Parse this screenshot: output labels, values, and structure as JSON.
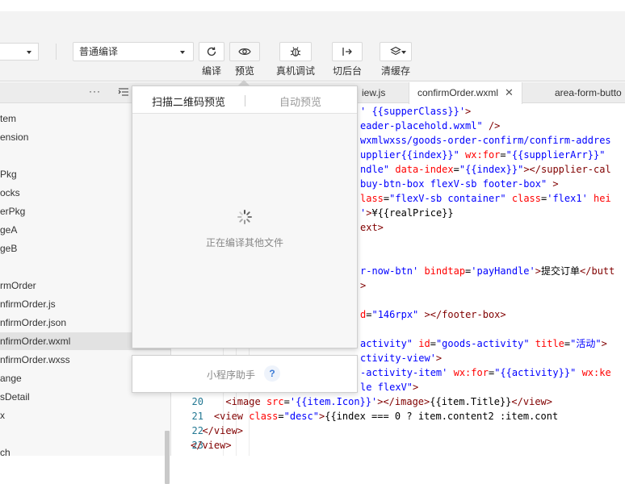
{
  "toolbar": {
    "left_select_value": "",
    "compile_mode_value": "普通编译",
    "buttons": [
      {
        "label": "编译",
        "icon": "refresh-icon"
      },
      {
        "label": "预览",
        "icon": "eye-icon"
      },
      {
        "label": "真机调试",
        "icon": "bug-icon"
      },
      {
        "label": "切后台",
        "icon": "switch-background-icon"
      },
      {
        "label": "清缓存",
        "icon": "layers-icon"
      }
    ]
  },
  "sidebar": {
    "header_more": "···",
    "items": [
      {
        "label": "tem",
        "selected": false
      },
      {
        "label": "ension",
        "selected": false
      },
      {
        "label": "",
        "selected": false
      },
      {
        "label": "Pkg",
        "selected": false
      },
      {
        "label": "ocks",
        "selected": false
      },
      {
        "label": "erPkg",
        "selected": false
      },
      {
        "label": "geA",
        "selected": false
      },
      {
        "label": "geB",
        "selected": false
      },
      {
        "label": "",
        "selected": false
      },
      {
        "label": "rmOrder",
        "selected": false
      },
      {
        "label": "nfirmOrder.js",
        "selected": false
      },
      {
        "label": "nfirmOrder.json",
        "selected": false
      },
      {
        "label": "nfirmOrder.wxml",
        "selected": true
      },
      {
        "label": "nfirmOrder.wxss",
        "selected": false
      },
      {
        "label": "ange",
        "selected": false
      },
      {
        "label": "sDetail",
        "selected": false
      },
      {
        "label": "x",
        "selected": false
      },
      {
        "label": "",
        "selected": false
      },
      {
        "label": "ch",
        "selected": false
      }
    ]
  },
  "tabs": [
    {
      "label": "iew.js",
      "active": false
    },
    {
      "label": "confirmOrder.wxml",
      "active": true,
      "close": "✕"
    },
    {
      "label": "area-form-butto",
      "active": false
    }
  ],
  "code": {
    "lines": [
      {
        "num": "",
        "segments": [
          {
            "t": "str",
            "v": "' {{supperClass}}'"
          },
          {
            "t": "tag",
            "v": ">"
          }
        ]
      },
      {
        "num": "",
        "segments": [
          {
            "t": "str",
            "v": "eader-placehold.wxml\""
          },
          {
            "t": "tag",
            "v": " />"
          }
        ]
      },
      {
        "num": "",
        "segments": [
          {
            "t": "str",
            "v": "wxmlwxss/goods-order-confirm/confirm-addres"
          }
        ]
      },
      {
        "num": "",
        "segments": [
          {
            "t": "str",
            "v": "upplier{{index}}\""
          },
          {
            "t": "attr",
            "v": " wx:for"
          },
          {
            "t": "txt",
            "v": "="
          },
          {
            "t": "str",
            "v": "\"{{supplierArr}}\""
          }
        ]
      },
      {
        "num": "",
        "segments": [
          {
            "t": "str",
            "v": "ndle\""
          },
          {
            "t": "attr",
            "v": " data-index"
          },
          {
            "t": "txt",
            "v": "="
          },
          {
            "t": "str",
            "v": "\"{{index}}\""
          },
          {
            "t": "tag",
            "v": "></supplier-cal"
          }
        ]
      },
      {
        "num": "",
        "segments": [
          {
            "t": "str",
            "v": "buy-btn-box flexV-sb footer-box\""
          },
          {
            "t": "tag",
            "v": " >"
          }
        ]
      },
      {
        "num": "",
        "segments": [
          {
            "t": "attr",
            "v": "lass"
          },
          {
            "t": "txt",
            "v": "="
          },
          {
            "t": "str",
            "v": "\"flexV-sb container\""
          },
          {
            "t": "attr",
            "v": " class"
          },
          {
            "t": "txt",
            "v": "="
          },
          {
            "t": "str",
            "v": "'flex1'"
          },
          {
            "t": "attr",
            "v": " hei"
          }
        ]
      },
      {
        "num": "",
        "segments": [
          {
            "t": "str",
            "v": "'"
          },
          {
            "t": "tag",
            "v": ">"
          },
          {
            "t": "txt",
            "v": "¥{{realPrice}}"
          }
        ]
      },
      {
        "num": "",
        "segments": [
          {
            "t": "tag",
            "v": "ext>"
          }
        ]
      },
      {
        "num": "",
        "segments": []
      },
      {
        "num": "",
        "segments": []
      },
      {
        "num": "",
        "segments": [
          {
            "t": "str",
            "v": "r-now-btn'"
          },
          {
            "t": "attr",
            "v": " bindtap"
          },
          {
            "t": "txt",
            "v": "="
          },
          {
            "t": "str",
            "v": "'payHandle'"
          },
          {
            "t": "tag",
            "v": ">"
          },
          {
            "t": "txt",
            "v": "提交订单"
          },
          {
            "t": "tag",
            "v": "</butt"
          }
        ]
      },
      {
        "num": "",
        "segments": [
          {
            "t": "tag",
            "v": ">"
          }
        ]
      },
      {
        "num": "",
        "segments": []
      },
      {
        "num": "",
        "segments": [
          {
            "t": "attr",
            "v": "d"
          },
          {
            "t": "txt",
            "v": "="
          },
          {
            "t": "str",
            "v": "\"146rpx\""
          },
          {
            "t": "tag",
            "v": " ></footer-box>"
          }
        ]
      },
      {
        "num": "",
        "segments": []
      },
      {
        "num": "",
        "segments": [
          {
            "t": "str",
            "v": "activity\""
          },
          {
            "t": "attr",
            "v": " id"
          },
          {
            "t": "txt",
            "v": "="
          },
          {
            "t": "str",
            "v": "\"goods-activity\""
          },
          {
            "t": "attr",
            "v": " title"
          },
          {
            "t": "txt",
            "v": "="
          },
          {
            "t": "str",
            "v": "\"活动\""
          },
          {
            "t": "tag",
            "v": ">"
          }
        ]
      },
      {
        "num": "",
        "segments": [
          {
            "t": "str",
            "v": "ctivity-view'"
          },
          {
            "t": "tag",
            "v": ">"
          }
        ]
      },
      {
        "num": "",
        "segments": [
          {
            "t": "str",
            "v": "-activity-item'"
          },
          {
            "t": "attr",
            "v": " wx:for"
          },
          {
            "t": "txt",
            "v": "="
          },
          {
            "t": "str",
            "v": "\"{{activity}}\""
          },
          {
            "t": "attr",
            "v": " wx:ke"
          }
        ]
      },
      {
        "num": "",
        "segments": [
          {
            "t": "str",
            "v": "le flexV\""
          },
          {
            "t": "tag",
            "v": ">"
          }
        ]
      },
      {
        "num": "20",
        "segments": [
          {
            "t": "txt",
            "v": "      "
          },
          {
            "t": "tag",
            "v": "<image"
          },
          {
            "t": "attr",
            "v": " src"
          },
          {
            "t": "txt",
            "v": "="
          },
          {
            "t": "str",
            "v": "'{{item.Icon}}'"
          },
          {
            "t": "tag",
            "v": "></image>"
          },
          {
            "t": "txt",
            "v": "{{item.Title}}"
          },
          {
            "t": "tag",
            "v": "</view>"
          }
        ]
      },
      {
        "num": "21",
        "segments": [
          {
            "t": "txt",
            "v": "    "
          },
          {
            "t": "tag",
            "v": "<view"
          },
          {
            "t": "attr",
            "v": " class"
          },
          {
            "t": "txt",
            "v": "="
          },
          {
            "t": "str",
            "v": "\"desc\""
          },
          {
            "t": "tag",
            "v": ">"
          },
          {
            "t": "txt",
            "v": "{{index === 0 ? item.content2 :item.cont"
          }
        ]
      },
      {
        "num": "22",
        "segments": [
          {
            "t": "txt",
            "v": "  "
          },
          {
            "t": "tag",
            "v": "</view>"
          }
        ]
      },
      {
        "num": "23",
        "segments": [
          {
            "t": "tag",
            "v": "</view>"
          }
        ]
      }
    ]
  },
  "preview_popup": {
    "tab_scan": "扫描二维码预览",
    "tab_auto": "自动预览",
    "loading_text": "正在编译其他文件"
  },
  "helper": {
    "label": "小程序助手",
    "help": "?"
  },
  "colors": {
    "toolbar_bg": "#f3f3f3",
    "code_tag": "#800000",
    "code_attr": "#ff0000",
    "code_string": "#0000ff",
    "line_number": "#237893",
    "help_blue": "#3c7bd6"
  }
}
